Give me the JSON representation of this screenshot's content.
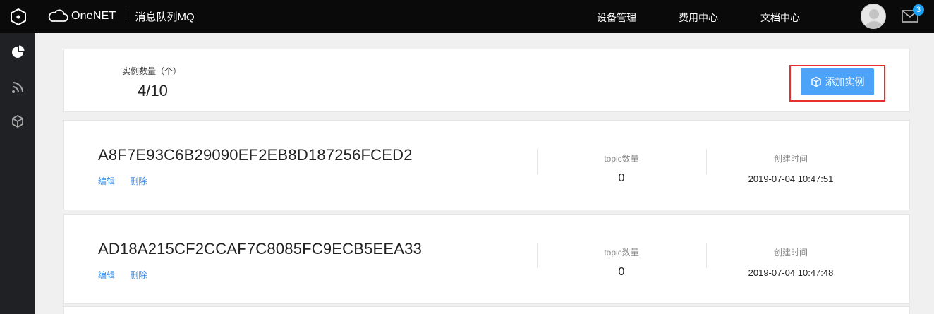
{
  "header": {
    "brand": "OneNET",
    "product_title": "消息队列MQ",
    "nav": [
      {
        "label": "设备管理"
      },
      {
        "label": "费用中心"
      },
      {
        "label": "文档中心"
      }
    ],
    "notification_count": "3"
  },
  "sidebar": {
    "icons": [
      "pie-chart-icon",
      "rss-feed-icon",
      "cube-icon"
    ]
  },
  "summary": {
    "count_label": "实例数量（个）",
    "count_value": "4/10",
    "add_button_label": "添加实例",
    "add_button_icon": "cube-icon"
  },
  "instances": [
    {
      "name": "A8F7E93C6B29090EF2EB8D187256FCED2",
      "edit_label": "编辑",
      "delete_label": "删除",
      "topic_label": "topic数量",
      "topic_count": "0",
      "created_label": "创建时间",
      "created_time": "2019-07-04 10:47:51"
    },
    {
      "name": "AD18A215CF2CCAF7C8085FC9ECB5EEA33",
      "edit_label": "编辑",
      "delete_label": "删除",
      "topic_label": "topic数量",
      "topic_count": "0",
      "created_label": "创建时间",
      "created_time": "2019-07-04 10:47:48"
    }
  ],
  "colors": {
    "topbar": "#0a0a0a",
    "sidebar": "#202124",
    "accent_button": "#4da3f7",
    "link": "#3a8ee6",
    "highlight_border": "#e8302f",
    "badge": "#1ca0f5"
  }
}
